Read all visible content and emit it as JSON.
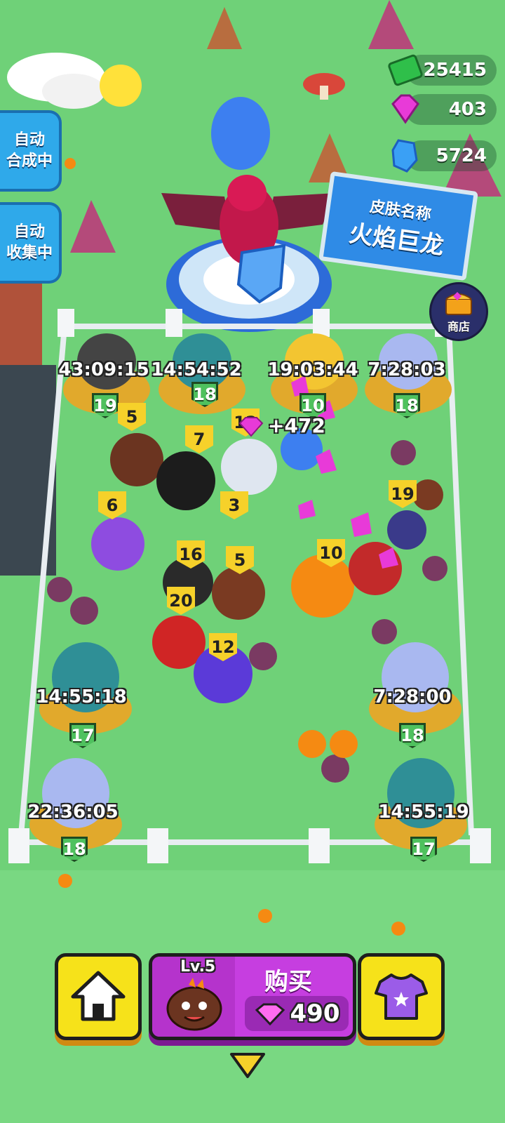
{
  "currencies": {
    "cash": "25415",
    "gems": "403",
    "crystals": "5724"
  },
  "side_buttons": {
    "auto_merge": [
      "自动",
      "合成中"
    ],
    "auto_collect": [
      "自动",
      "收集中"
    ]
  },
  "skin_sign": {
    "label": "皮肤名称",
    "name": "火焰巨龙"
  },
  "shop": {
    "label": "商店"
  },
  "eggs": [
    {
      "timer": "43:09:15",
      "level": "19"
    },
    {
      "timer": "14:54:52",
      "level": "18"
    },
    {
      "timer": "19:03:44",
      "level": "10"
    },
    {
      "timer": "7:28:03",
      "level": "18"
    },
    {
      "timer": "14:55:18",
      "level": "17"
    },
    {
      "timer": "7:28:00",
      "level": "18"
    },
    {
      "timer": "22:36:05",
      "level": "18"
    },
    {
      "timer": "14:55:19",
      "level": "17"
    }
  ],
  "creature_levels": [
    "5",
    "7",
    "12",
    "3",
    "6",
    "19",
    "16",
    "5",
    "10",
    "20",
    "12"
  ],
  "reward_popup": "+472",
  "bottom_bar": {
    "buy": {
      "level": "Lv.5",
      "label": "购买",
      "price": "490"
    }
  },
  "colors": {
    "grass": "#6fd178",
    "buy_button": "#c63ee0",
    "yellow_button": "#f6e21a",
    "side_button": "#2fa9ea"
  }
}
